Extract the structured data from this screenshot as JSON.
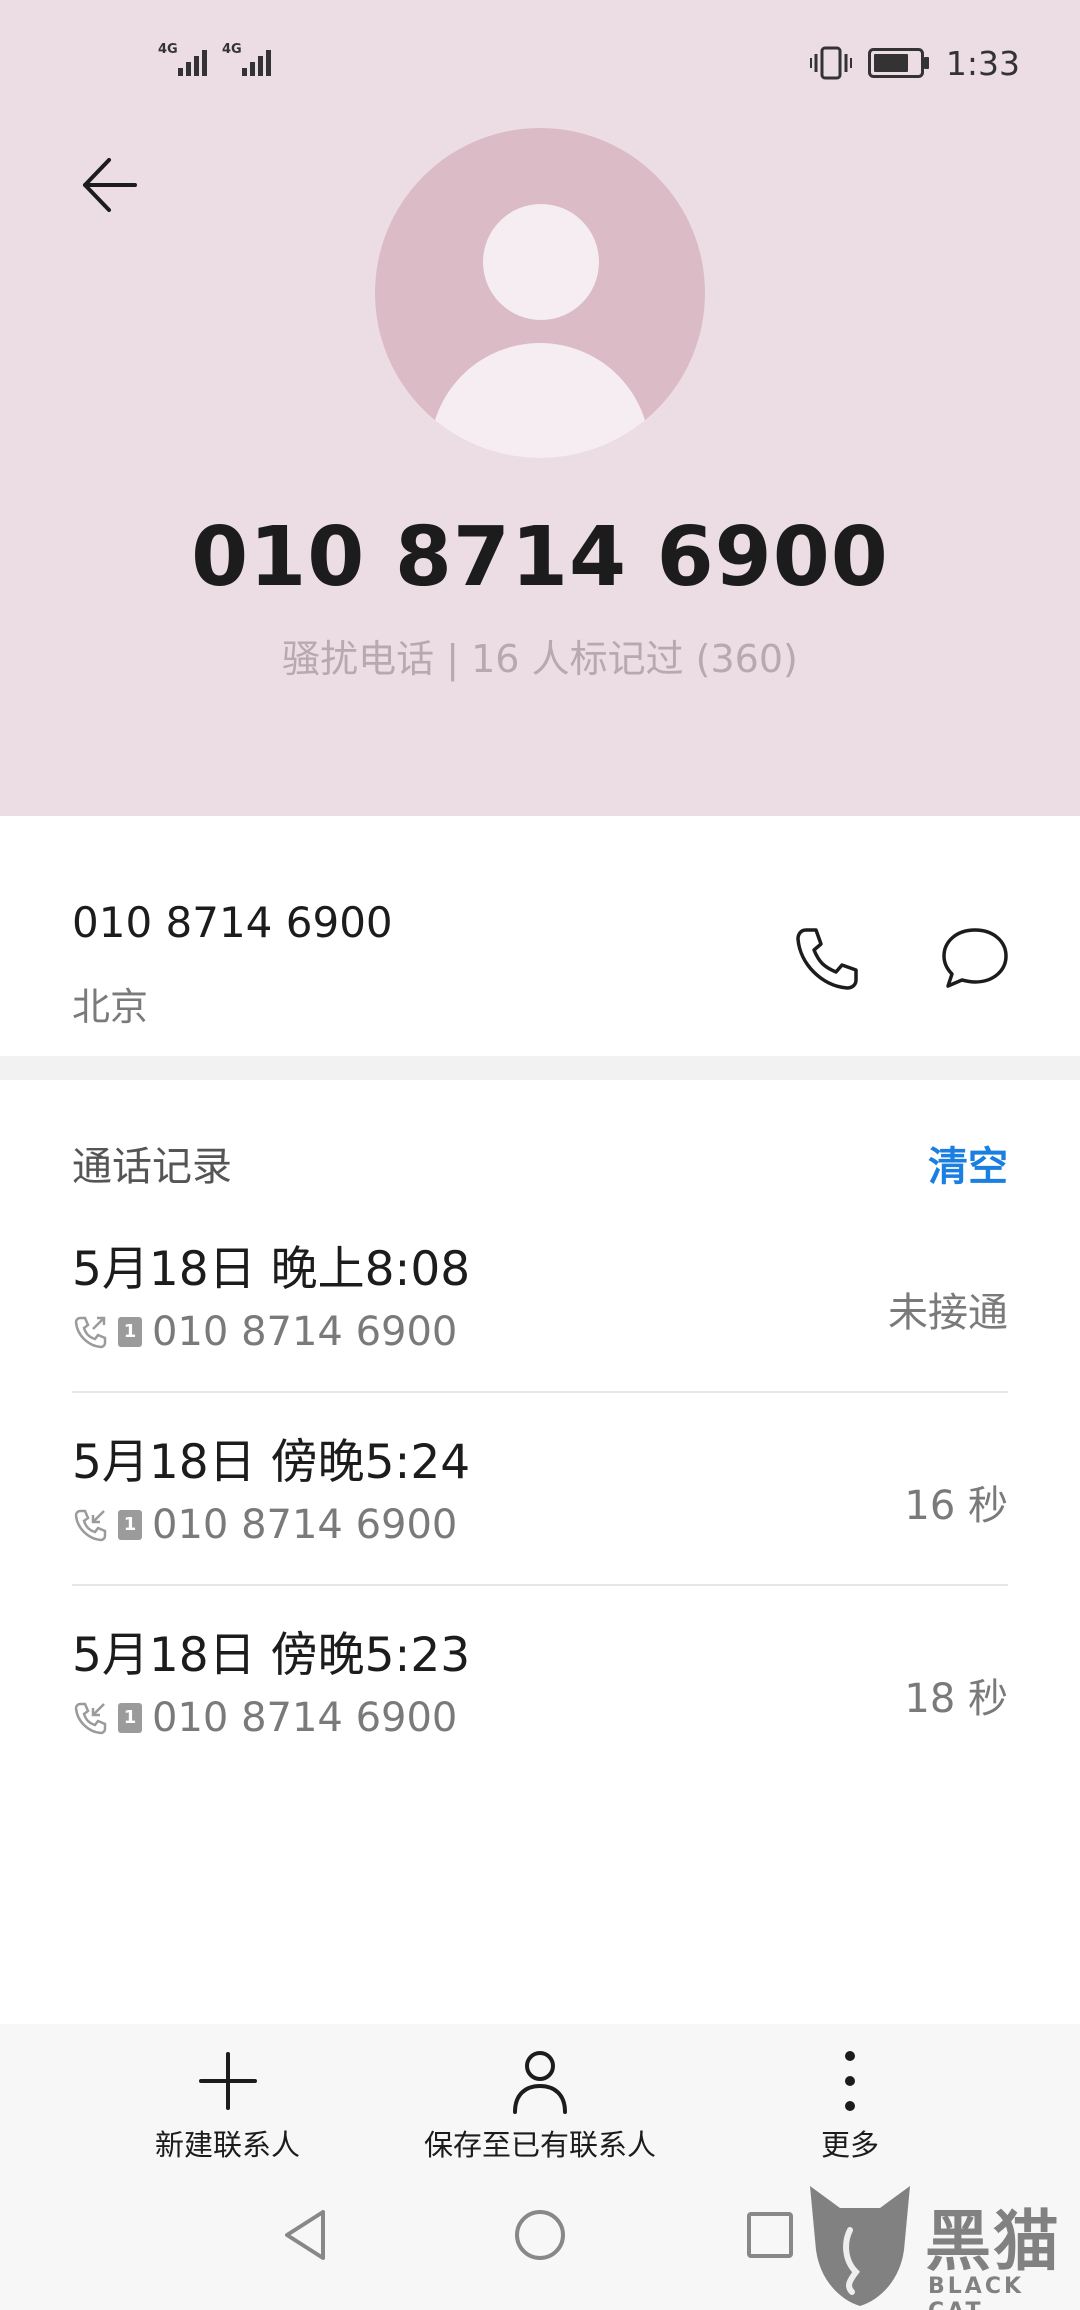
{
  "status_bar": {
    "signal_1": "4G",
    "signal_2": "4G",
    "time": "1:33",
    "vibrate_icon": "vibrate-icon",
    "battery_icon": "battery-icon"
  },
  "header": {
    "back_icon": "arrow-left-icon",
    "avatar_icon": "person-avatar-icon",
    "number": "010 8714 6900",
    "tag": "骚扰电话 | 16 人标记过 (360)"
  },
  "contact": {
    "number": "010 8714 6900",
    "location": "北京",
    "call_icon": "phone-icon",
    "message_icon": "message-icon"
  },
  "call_log": {
    "title": "通话记录",
    "clear_label": "清空",
    "items": [
      {
        "when": "5月18日 晚上8:08",
        "number": "010 8714 6900",
        "sim": "1",
        "result": "未接通",
        "type_icon": "outgoing-call-icon"
      },
      {
        "when": "5月18日 傍晚5:24",
        "number": "010 8714 6900",
        "sim": "1",
        "result": "16 秒",
        "type_icon": "incoming-call-icon"
      },
      {
        "when": "5月18日 傍晚5:23",
        "number": "010 8714 6900",
        "sim": "1",
        "result": "18 秒",
        "type_icon": "incoming-call-icon"
      }
    ]
  },
  "actions": {
    "new_contact": "新建联系人",
    "save_existing": "保存至已有联系人",
    "more": "更多"
  },
  "nav": {
    "back_icon": "nav-back-icon",
    "home_icon": "nav-home-icon",
    "recents_icon": "nav-recents-icon"
  },
  "watermark": {
    "text": "黑猫",
    "sub": "BLACK CAT"
  },
  "colors": {
    "header_bg": "#ecdde5",
    "avatar_bg": "#dabbc6",
    "accent": "#1a7fe0"
  }
}
